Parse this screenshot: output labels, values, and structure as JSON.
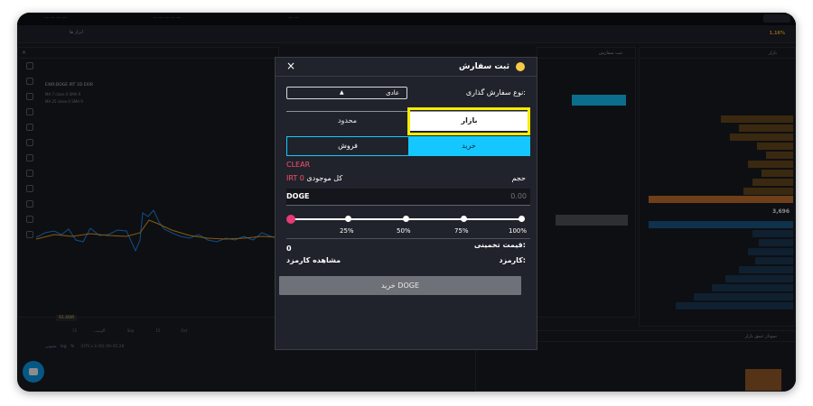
{
  "modal": {
    "title": "ثبت سفارش",
    "order_type_label": "نوع سفارش گذاری:",
    "order_type_value": "عادی",
    "tabs": [
      "محدود",
      "بازار"
    ],
    "active_tab": "بازار",
    "sell_label": "فروش",
    "buy_label": "خرید",
    "clear_label": "CLEAR",
    "volume_label": "حجم",
    "balance_label": "کل موجودی",
    "balance_value": "IRT 0",
    "input_unit": "DOGE",
    "input_value": "0.00",
    "slider_marks": [
      "25%",
      "50%",
      "75%",
      "100%"
    ],
    "slider_value_percent": 0,
    "estimate_label": "قیمت تخمینی:",
    "estimate_value": "0",
    "fee_label": "کارمزد:",
    "fee_link": "مشاهده کارمزد",
    "submit_label": "خرید DOGE"
  },
  "background": {
    "ticker": "1.16%",
    "chart_symbol": "EXIR:DOGE IRT 1D EXIR",
    "chart_ma1": "MA 7 close 0 SMA 9",
    "chart_ma2": "MA 25 close 0 SMA 9",
    "price_tag": "91.40IR",
    "xaxis_labels": [
      "آگوست",
      "15",
      "Sep",
      "15",
      "Oct"
    ],
    "chart_footer": "(UTC+3:30) 09:45:28",
    "chart_footer_buttons": [
      "ستونی",
      "log",
      "%"
    ],
    "orderbook_mid_price": "3,696",
    "panel_titles": [
      "بازار",
      "ثبت سفارش",
      "نمودار عمق بازار"
    ],
    "tab_label": "ابزار ها",
    "colors": {
      "buy": "#14c8ff",
      "sell_highlight": "#f5ec00",
      "clear": "#ff4f6b",
      "accent_orange": "#f5a623"
    }
  }
}
